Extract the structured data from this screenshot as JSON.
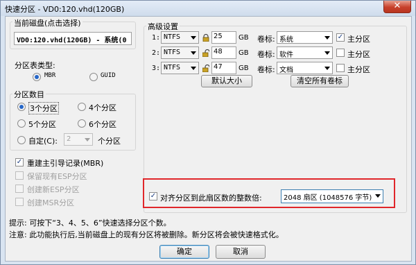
{
  "window": {
    "title": "快速分区 - VD0:120.vhd(120GB)",
    "close_glyph": "✕"
  },
  "disk": {
    "group_title": "当前磁盘(点击选择)",
    "value": "VD0:120.vhd(120GB) - 系统(0"
  },
  "partition_table": {
    "label": "分区表类型:",
    "options": [
      "MBR",
      "GUID"
    ],
    "selected": "MBR"
  },
  "partition_count": {
    "group_title": "分区数目",
    "options": [
      "3个分区",
      "4个分区",
      "5个分区",
      "6个分区"
    ],
    "selected": "3个分区",
    "custom_label": "自定(C):",
    "custom_value": "2",
    "custom_suffix": "个分区"
  },
  "mbr_options": {
    "rebuild_mbr": "重建主引导记录(MBR)",
    "keep_esp": "保留现有ESP分区",
    "create_esp": "创建新ESP分区",
    "create_msr": "创建MSR分区"
  },
  "advanced": {
    "group_title": "高级设置",
    "size_unit": "GB",
    "volume_label_prefix": "卷标:",
    "primary_label": "主分区",
    "rows": [
      {
        "index": "1:",
        "fs": "NTFS",
        "size": "25",
        "label": "系统",
        "primary": true,
        "lock": "closed"
      },
      {
        "index": "2:",
        "fs": "NTFS",
        "size": "48",
        "label": "软件",
        "primary": false,
        "lock": "open"
      },
      {
        "index": "3:",
        "fs": "NTFS",
        "size": "47",
        "label": "文档",
        "primary": false,
        "lock": "open"
      }
    ],
    "default_size_button": "默认大小",
    "clear_labels_button": "清空所有卷标"
  },
  "alignment": {
    "label": "对齐分区到此扇区数的整数倍:",
    "value": "2048 扇区 (1048576 字节)",
    "checked": true
  },
  "hints": {
    "tip": "提示: 可按下“3、4、5、6”快速选择分区个数。",
    "note": "注意: 此功能执行后,当前磁盘上的现有分区将被删除。新分区将会被快速格式化。"
  },
  "buttons": {
    "ok": "确定",
    "cancel": "取消"
  },
  "colors": {
    "highlight_border": "#e0262a",
    "checkmark": "#1a3c80",
    "radio_dot": "#2566c8"
  }
}
